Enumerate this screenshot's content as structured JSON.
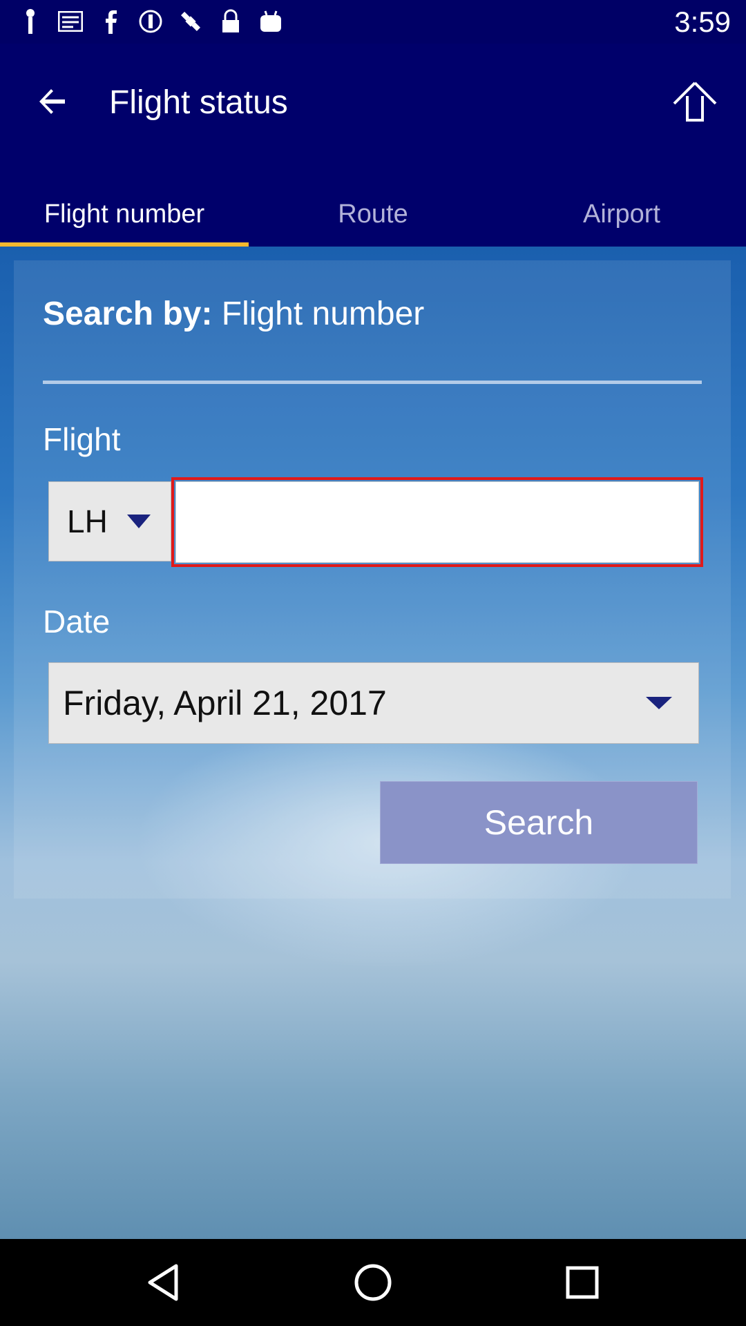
{
  "status_bar": {
    "time": "3:59",
    "icons": [
      "gps-tracking-icon",
      "message-icon",
      "facebook-icon",
      "circle-i-icon",
      "fake-gps-icon",
      "lock-icon",
      "android-icon"
    ]
  },
  "app_bar": {
    "title": "Flight status"
  },
  "tabs": [
    {
      "label": "Flight number",
      "active": true
    },
    {
      "label": "Route",
      "active": false
    },
    {
      "label": "Airport",
      "active": false
    }
  ],
  "form": {
    "search_by_label": "Search by:",
    "search_by_value": "Flight number",
    "flight_label": "Flight",
    "airline_code": "LH",
    "flight_number_value": "",
    "date_label": "Date",
    "date_value": "Friday, April 21, 2017",
    "search_button": "Search"
  },
  "colors": {
    "app_bar": "#00006b",
    "tab_indicator": "#f5b82e",
    "highlight_border": "#e01a1a",
    "search_button": "#8a93c8"
  }
}
